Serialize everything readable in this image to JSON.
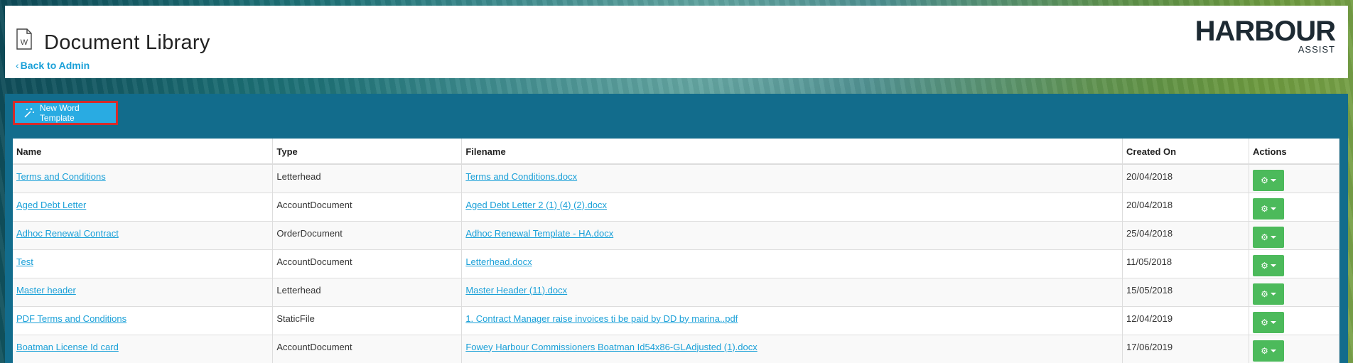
{
  "header": {
    "title": "Document Library",
    "back_label": "Back to Admin",
    "logo_main": "HARBOUR",
    "logo_sub": "ASSIST"
  },
  "toolbar": {
    "new_template_label": "New Word Template"
  },
  "table": {
    "columns": [
      "Name",
      "Type",
      "Filename",
      "Created On",
      "Actions"
    ],
    "rows": [
      {
        "name": "Terms and Conditions",
        "type": "Letterhead",
        "filename": "Terms and Conditions.docx",
        "created": "20/04/2018"
      },
      {
        "name": "Aged Debt Letter",
        "type": "AccountDocument",
        "filename": "Aged Debt Letter 2 (1) (4) (2).docx",
        "created": "20/04/2018"
      },
      {
        "name": "Adhoc Renewal Contract",
        "type": "OrderDocument",
        "filename": "Adhoc Renewal Template - HA.docx",
        "created": "25/04/2018"
      },
      {
        "name": "Test",
        "type": "AccountDocument",
        "filename": "Letterhead.docx",
        "created": "11/05/2018"
      },
      {
        "name": "Master header",
        "type": "Letterhead",
        "filename": "Master Header (11).docx",
        "created": "15/05/2018"
      },
      {
        "name": "PDF Terms and Conditions",
        "type": "StaticFile",
        "filename": "1. Contract Manager raise invoices ti be paid by DD by marina..pdf",
        "created": "12/04/2019"
      },
      {
        "name": "Boatman License Id card",
        "type": "AccountDocument",
        "filename": "Fowey Harbour Commissioners Boatman Id54x86-GLAdjusted (1).docx",
        "created": "17/06/2019"
      }
    ]
  },
  "colors": {
    "accent": "#1aa0d8",
    "panel": "#126c8c",
    "action_button": "#4cba5b",
    "highlight_border": "#d52b2b"
  }
}
